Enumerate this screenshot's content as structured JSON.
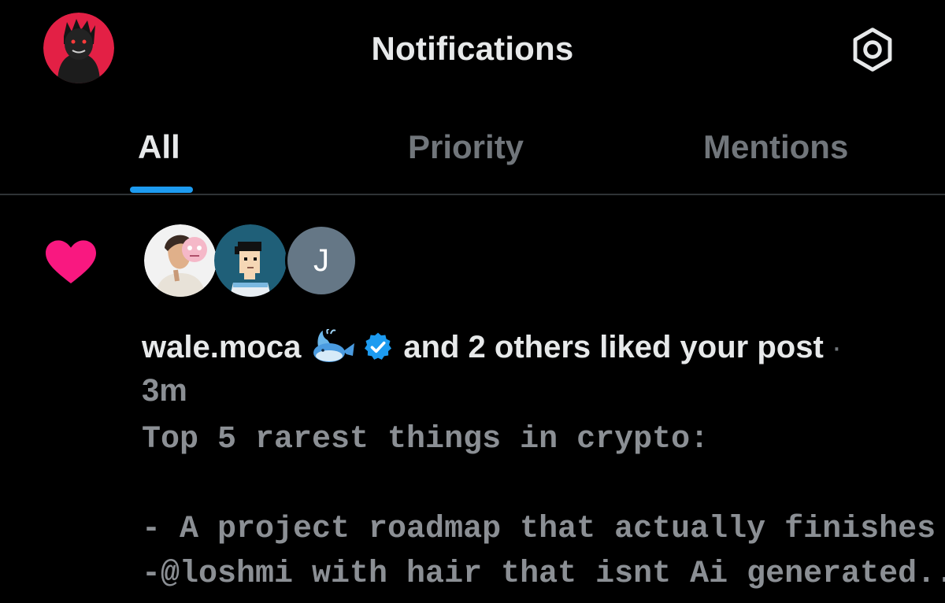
{
  "header": {
    "title": "Notifications",
    "profile_avatar_icon": "profile-avatar",
    "settings_icon": "gear-icon"
  },
  "tabs": [
    {
      "label": "All",
      "active": true
    },
    {
      "label": "Priority",
      "active": false
    },
    {
      "label": "Mentions",
      "active": false
    }
  ],
  "notification": {
    "type_icon": "heart-icon",
    "avatars": [
      {
        "icon": "avatar-illustration"
      },
      {
        "icon": "avatar-pixel-art"
      },
      {
        "initial": "J"
      }
    ],
    "username": "wale.moca",
    "emoji_icon": "whale-icon",
    "verified_icon": "verified-badge-icon",
    "action_text": "and 2 others liked your post",
    "separator": "·",
    "time": "3m",
    "post_text": "Top 5 rarest things in crypto:\n\n- A project roadmap that actually finishes\n-@loshmi with hair that isnt Ai generated..."
  },
  "colors": {
    "background": "#000000",
    "accent": "#1d9bf0",
    "heart": "#f91880",
    "primary_text": "#e7e9ea",
    "secondary_text": "#71767b"
  }
}
